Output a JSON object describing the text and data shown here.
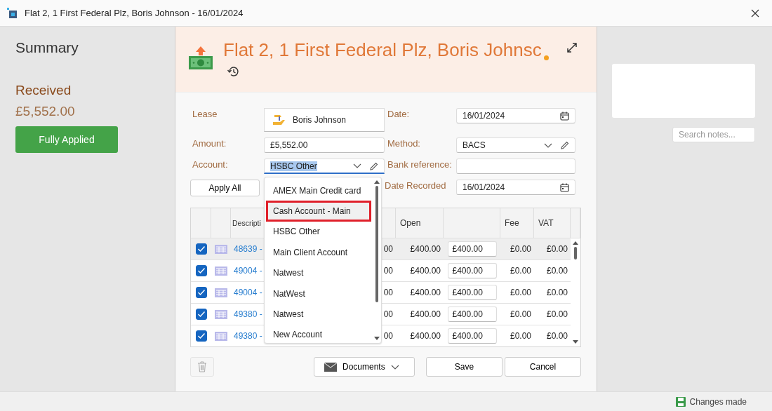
{
  "window": {
    "title": "Flat 2, 1 First Federal Plz, Boris Johnson - 16/01/2024"
  },
  "summary": {
    "title": "Summary",
    "received_label": "Received",
    "received_amount": "£5,552.00",
    "status_button": "Fully Applied"
  },
  "header": {
    "title": "Flat 2, 1 First Federal Plz, Boris Johnsc",
    "unsaved": true
  },
  "form": {
    "lease": {
      "label": "Lease",
      "value": "Boris Johnson"
    },
    "date": {
      "label": "Date:",
      "value": "16/01/2024"
    },
    "amount": {
      "label": "Amount:",
      "value": "£5,552.00"
    },
    "method": {
      "label": "Method:",
      "value": "BACS"
    },
    "account": {
      "label": "Account:",
      "value": "HSBC Other",
      "text_selected": true
    },
    "bank_reference": {
      "label": "Bank reference:"
    },
    "date_recorded": {
      "label": "Date Recorded",
      "value": "16/01/2024"
    },
    "apply_all_button": "Apply All"
  },
  "account_dropdown": {
    "options": [
      {
        "label": "AMEX Main Credit card",
        "selected": false
      },
      {
        "label": "Cash Account - Main",
        "selected": true
      },
      {
        "label": "HSBC Other",
        "selected": false
      },
      {
        "label": "Main Client Account",
        "selected": false
      },
      {
        "label": "Natwest",
        "selected": false
      },
      {
        "label": "NatWest",
        "selected": false
      },
      {
        "label": "Natwest",
        "selected": false
      },
      {
        "label": "New Account",
        "selected": false
      }
    ]
  },
  "table": {
    "columns": {
      "description": "Descripti",
      "open": "Open",
      "fee": "Fee",
      "vat": "VAT"
    },
    "rows": [
      {
        "checked": true,
        "selected": true,
        "description": "48639 -",
        "column_4": "00",
        "open": "£400.00",
        "allocated": "£400.00",
        "fee": "£0.00",
        "vat": "£0.00"
      },
      {
        "checked": true,
        "selected": false,
        "description": "49004 -",
        "column_4": "00",
        "open": "£400.00",
        "allocated": "£400.00",
        "fee": "£0.00",
        "vat": "£0.00"
      },
      {
        "checked": true,
        "selected": false,
        "description": "49004 -",
        "column_4": "00",
        "open": "£400.00",
        "allocated": "£400.00",
        "fee": "£0.00",
        "vat": "£0.00"
      },
      {
        "checked": true,
        "selected": false,
        "description": "49380 -",
        "column_4": "00",
        "open": "£400.00",
        "allocated": "£400.00",
        "fee": "£0.00",
        "vat": "£0.00"
      },
      {
        "checked": true,
        "selected": false,
        "description": "49380 -",
        "column_4": "00",
        "open": "£400.00",
        "allocated": "£400.00",
        "fee": "£0.00",
        "vat": "£0.00"
      }
    ]
  },
  "footer": {
    "documents_button": "Documents",
    "save_button": "Save",
    "cancel_button": "Cancel"
  },
  "notes": {
    "search_placeholder": "Search notes..."
  },
  "status_bar": {
    "message": "Changes made"
  }
}
